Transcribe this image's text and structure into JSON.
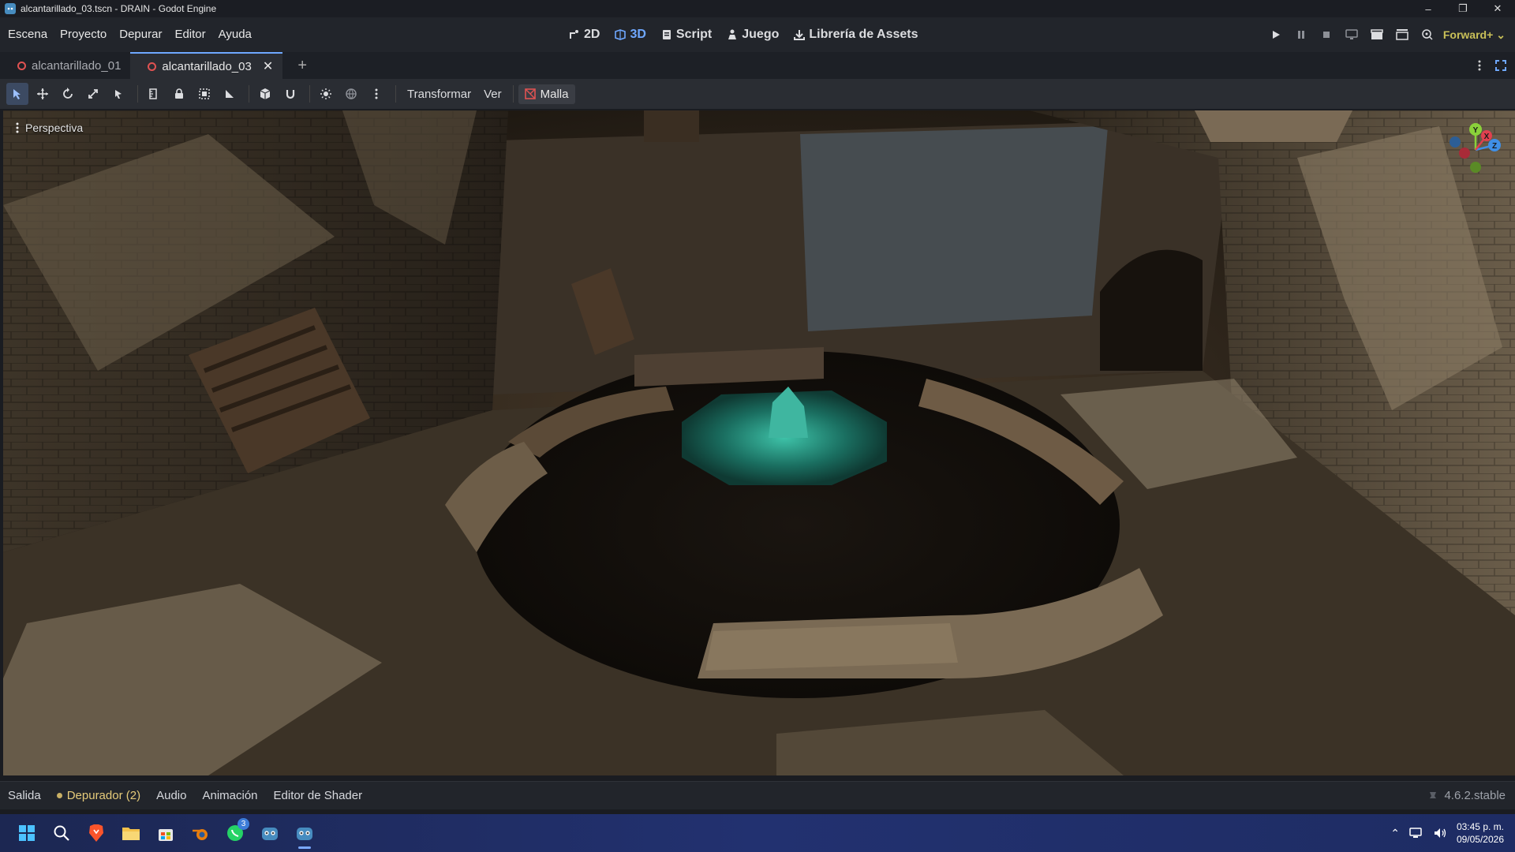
{
  "window": {
    "title": "alcantarillado_03.tscn - DRAIN - Godot Engine"
  },
  "menu": {
    "items": [
      "Escena",
      "Proyecto",
      "Depurar",
      "Editor",
      "Ayuda"
    ]
  },
  "main_screens": [
    {
      "label": "2D",
      "icon": "2d-icon"
    },
    {
      "label": "3D",
      "icon": "3d-icon",
      "active": true
    },
    {
      "label": "Script",
      "icon": "script-icon"
    },
    {
      "label": "Juego",
      "icon": "game-icon"
    },
    {
      "label": "Librería de Assets",
      "icon": "assetlib-icon"
    }
  ],
  "renderer": {
    "label": "Forward+"
  },
  "tabs": [
    {
      "label": "alcantarillado_01",
      "active": false
    },
    {
      "label": "alcantarillado_03",
      "active": true
    }
  ],
  "toolbar": {
    "transform_label": "Transformar",
    "view_label": "Ver",
    "mesh_label": "Malla"
  },
  "viewport": {
    "perspective_label": "Perspectiva",
    "gizmo": {
      "x": "X",
      "y": "Y",
      "z": "Z"
    },
    "colors": {
      "x": "#e0404f",
      "y": "#8ad13a",
      "z": "#3f8fe6"
    }
  },
  "bottom_panel": {
    "items": [
      "Salida",
      "Depurador (2)",
      "Audio",
      "Animación",
      "Editor de Shader"
    ],
    "version": "4.6.2.stable"
  },
  "taskbar": {
    "time": "03:45 p. m.",
    "date": "09/05/2026",
    "whatsapp_badge": "3"
  },
  "colors": {
    "accent": "#6fa8ff",
    "renderer": "#c9c058",
    "warning": "#e6cb7a"
  }
}
